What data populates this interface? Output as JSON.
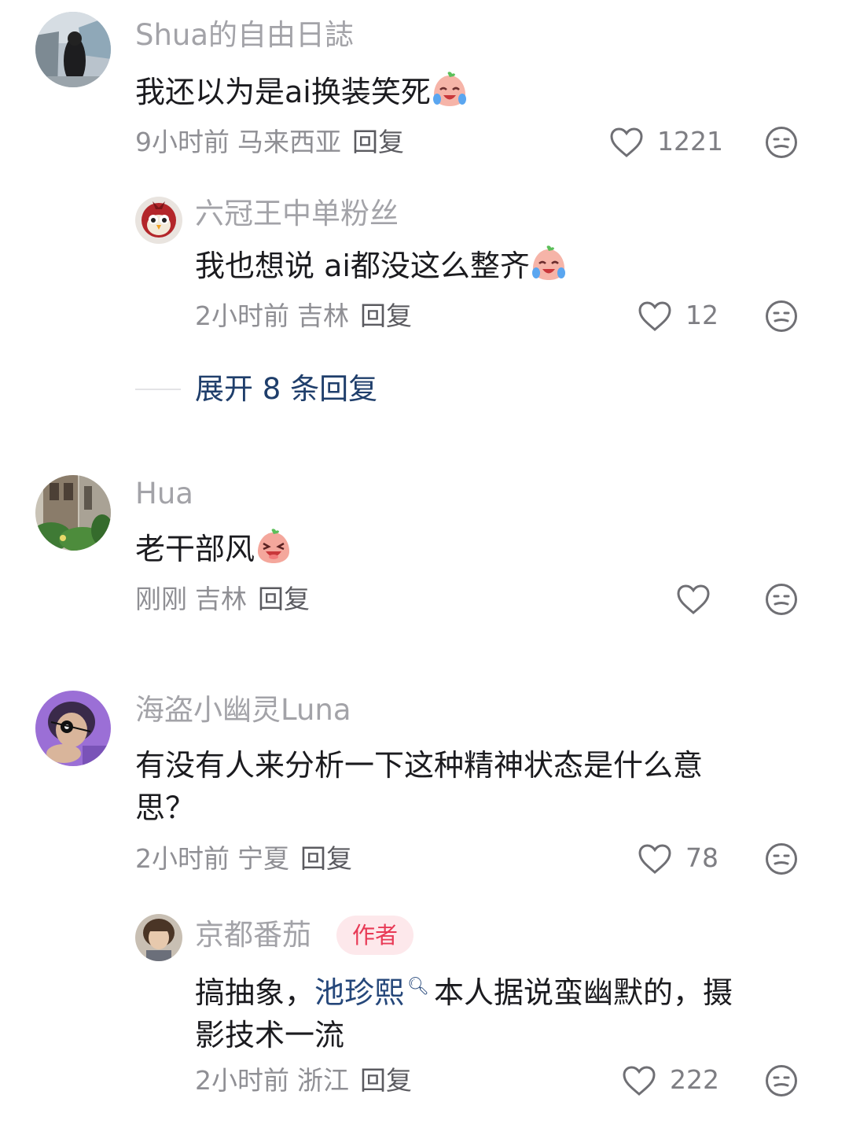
{
  "comments": [
    {
      "username": "Shua的自由日誌",
      "text": "我还以为是ai换装笑死",
      "time": "9小时前",
      "location": "马来西亚",
      "reply_label": "回复",
      "likes": "1221",
      "emoji": "crying-laughing-peach-emoji"
    },
    {
      "username": "六冠王中单粉丝",
      "text": "我也想说 ai都没这么整齐",
      "time": "2小时前",
      "location": "吉林",
      "reply_label": "回复",
      "likes": "12",
      "emoji": "crying-laughing-peach-emoji"
    },
    {
      "username": "Hua",
      "text": "老干部风",
      "time": "刚刚",
      "location": "吉林",
      "reply_label": "回复",
      "likes": "",
      "emoji": "grinning-peach-emoji"
    },
    {
      "username": "海盗小幽灵Luna",
      "text_line1": "有没有人来分析一下这种精神状态是什么意",
      "text_line2": "思？",
      "time": "2小时前",
      "location": "宁夏",
      "reply_label": "回复",
      "likes": "78"
    },
    {
      "username": "京都番茄",
      "badge": "作者",
      "text_prefix": "搞抽象，",
      "mention": "池珍熙",
      "mention_icon": "search-icon",
      "text_suffix": "本人据说蛮幽默的，摄",
      "text_line2": "影技术一流",
      "time": "2小时前",
      "location": "浙江",
      "reply_label": "回复",
      "likes": "222"
    }
  ],
  "expand_replies": "展开 8 条回复",
  "colors": {
    "link": "#1f3e6b",
    "badge_text": "#e83a56",
    "badge_bg": "#fde8eb",
    "meta": "#8f8f94"
  }
}
